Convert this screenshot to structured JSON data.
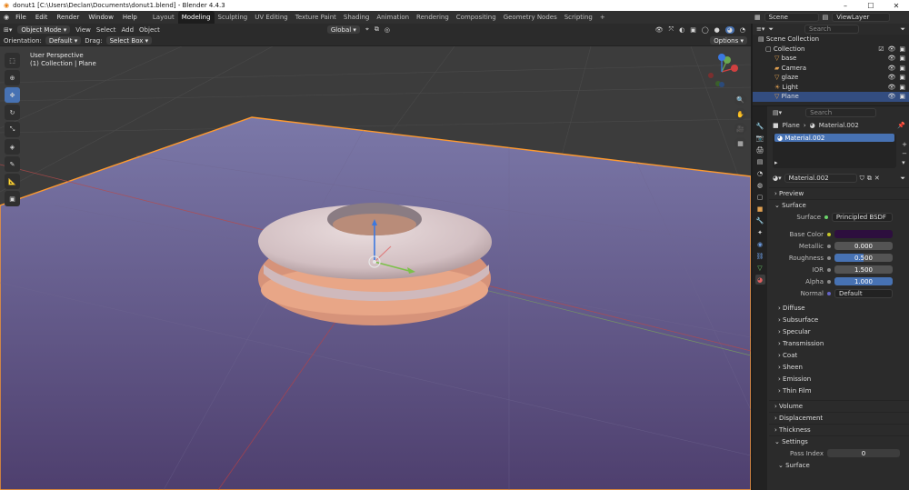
{
  "window": {
    "title": "donut1 [C:\\Users\\Declan\\Documents\\donut1.blend] - Blender 4.4.3"
  },
  "menu": [
    "File",
    "Edit",
    "Render",
    "Window",
    "Help"
  ],
  "workspaces": [
    "Layout",
    "Modeling",
    "Sculpting",
    "UV Editing",
    "Texture Paint",
    "Shading",
    "Animation",
    "Rendering",
    "Compositing",
    "Geometry Nodes",
    "Scripting"
  ],
  "active_workspace": "Modeling",
  "scene": {
    "name": "Scene",
    "view_layer": "ViewLayer"
  },
  "viewport_header": {
    "mode": "Object Mode",
    "menus": [
      "View",
      "Select",
      "Add",
      "Object"
    ],
    "transform": "Global",
    "orientation_label": "Orientation:",
    "orientation_value": "Default",
    "drag_label": "Drag:",
    "drag_value": "Select Box",
    "options": "Options"
  },
  "viewport": {
    "perspective": "User Perspective",
    "context": "(1) Collection | Plane"
  },
  "outliner": {
    "search_placeholder": "Search",
    "root": "Scene Collection",
    "collection": "Collection",
    "items": [
      "base",
      "Camera",
      "glaze",
      "Light",
      "Plane"
    ],
    "selected": "Plane"
  },
  "properties": {
    "search_placeholder": "Search",
    "breadcrumb_object": "Plane",
    "breadcrumb_material": "Material.002",
    "slot": "Material.002",
    "material_name": "Material.002",
    "sections": {
      "preview": "Preview",
      "surface": "Surface",
      "volume": "Volume",
      "displacement": "Displacement",
      "thickness": "Thickness",
      "settings": "Settings"
    },
    "surface_label": "Surface",
    "surface_value": "Principled BSDF",
    "base_color_label": "Base Color",
    "base_color": "#2d0f3e",
    "metallic": {
      "label": "Metallic",
      "value": "0.000"
    },
    "roughness": {
      "label": "Roughness",
      "value": "0.500",
      "fraction": 0.5
    },
    "ior": {
      "label": "IOR",
      "value": "1.500",
      "fraction": 0.3
    },
    "alpha": {
      "label": "Alpha",
      "value": "1.000",
      "fraction": 1.0
    },
    "normal": {
      "label": "Normal",
      "value": "Default"
    },
    "subpanels": [
      "Diffuse",
      "Subsurface",
      "Specular",
      "Transmission",
      "Coat",
      "Sheen",
      "Emission",
      "Thin Film"
    ],
    "pass_index": {
      "label": "Pass Index",
      "value": "0"
    },
    "settings_sub": "Surface"
  },
  "colors": {
    "accent": "#4772b3",
    "selection_outline": "#ff9a2e",
    "plane": "#5e5478"
  }
}
